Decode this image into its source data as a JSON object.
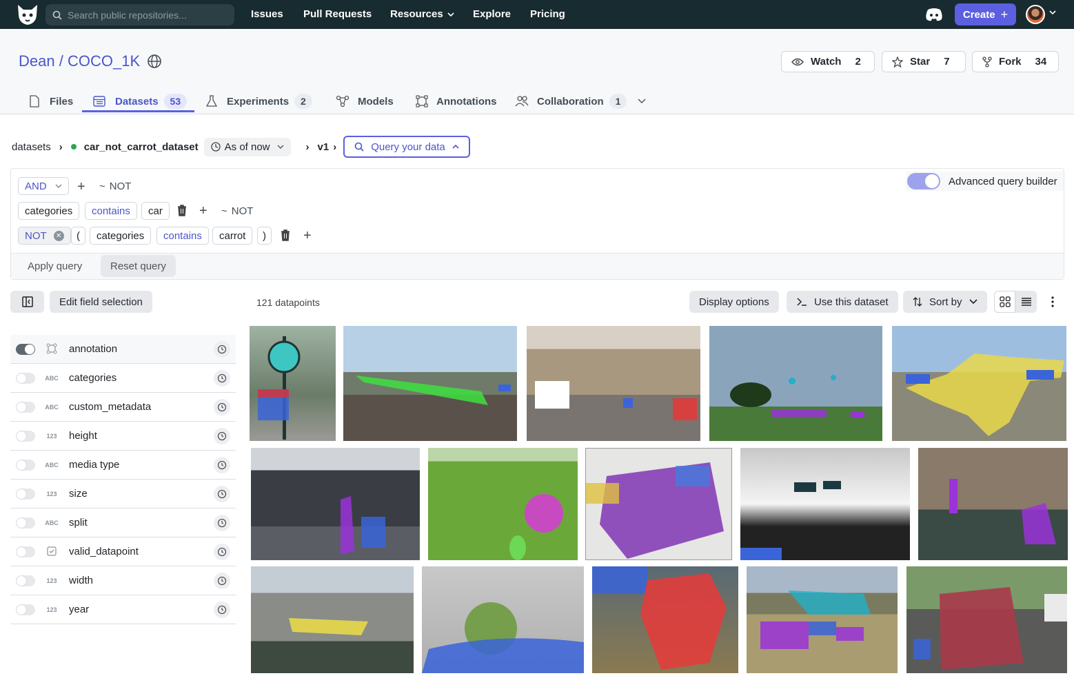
{
  "nav": {
    "search_placeholder": "Search public repositories...",
    "links": [
      "Issues",
      "Pull Requests",
      "Resources",
      "Explore",
      "Pricing"
    ],
    "create_label": "Create"
  },
  "repo": {
    "owner": "Dean",
    "separator": "/",
    "name": "COCO_1K",
    "watch": {
      "label": "Watch",
      "count": "2"
    },
    "star": {
      "label": "Star",
      "count": "7"
    },
    "fork": {
      "label": "Fork",
      "count": "34"
    }
  },
  "tabs": {
    "files": {
      "label": "Files"
    },
    "datasets": {
      "label": "Datasets",
      "count": "53"
    },
    "experiments": {
      "label": "Experiments",
      "count": "2"
    },
    "models": {
      "label": "Models"
    },
    "annotations": {
      "label": "Annotations"
    },
    "collaboration": {
      "label": "Collaboration",
      "count": "1"
    }
  },
  "breadcrumb": {
    "root": "datasets",
    "dataset": "car_not_carrot_dataset",
    "as_of": "As of now",
    "version": "v1",
    "query_label": "Query your data"
  },
  "query": {
    "combinator": "AND",
    "not_label": "NOT",
    "row1": {
      "field": "categories",
      "op": "contains",
      "value": "car"
    },
    "row2": {
      "prefix": "NOT",
      "open": "(",
      "field": "categories",
      "op": "contains",
      "value": "carrot",
      "close": ")"
    },
    "advanced_label": "Advanced query builder",
    "apply_label": "Apply query",
    "reset_label": "Reset query"
  },
  "toolbar": {
    "edit_fields_label": "Edit field selection",
    "count_label": "121 datapoints",
    "display_options_label": "Display options",
    "use_dataset_label": "Use this dataset",
    "sort_label": "Sort by"
  },
  "fields": [
    {
      "name": "annotation",
      "type": "",
      "enabled": true
    },
    {
      "name": "categories",
      "type": "ABC",
      "enabled": false
    },
    {
      "name": "custom_metadata",
      "type": "ABC",
      "enabled": false
    },
    {
      "name": "height",
      "type": "123",
      "enabled": false
    },
    {
      "name": "media type",
      "type": "ABC",
      "enabled": false
    },
    {
      "name": "size",
      "type": "123",
      "enabled": false
    },
    {
      "name": "split",
      "type": "ABC",
      "enabled": false
    },
    {
      "name": "valid_datapoint",
      "type": "",
      "enabled": false
    },
    {
      "name": "width",
      "type": "123",
      "enabled": false
    },
    {
      "name": "year",
      "type": "123",
      "enabled": false
    }
  ],
  "colors": {
    "accent": "#5b5fe0",
    "topbar": "#172b30",
    "link": "#4b55c9"
  }
}
